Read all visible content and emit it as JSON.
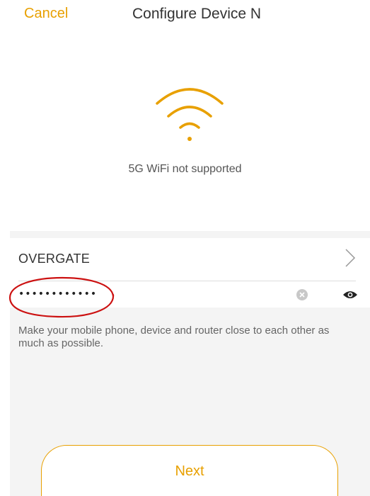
{
  "header": {
    "cancel_label": "Cancel",
    "title": "Configure Device N"
  },
  "status": {
    "wifi_icon": "wifi-icon",
    "message": "5G WiFi not supported"
  },
  "network": {
    "ssid": "OVERGATE",
    "chevron_icon": "chevron-right-icon"
  },
  "password": {
    "value": "••••••••••••",
    "clear_icon": "clear-icon",
    "visibility_icon": "eye-icon"
  },
  "hint": "Make your mobile phone, device and router close to each other as much as possible.",
  "next_label": "Next",
  "colors": {
    "accent": "#e8a000",
    "annotation": "#cc1111",
    "background_gray": "#f4f4f4"
  }
}
